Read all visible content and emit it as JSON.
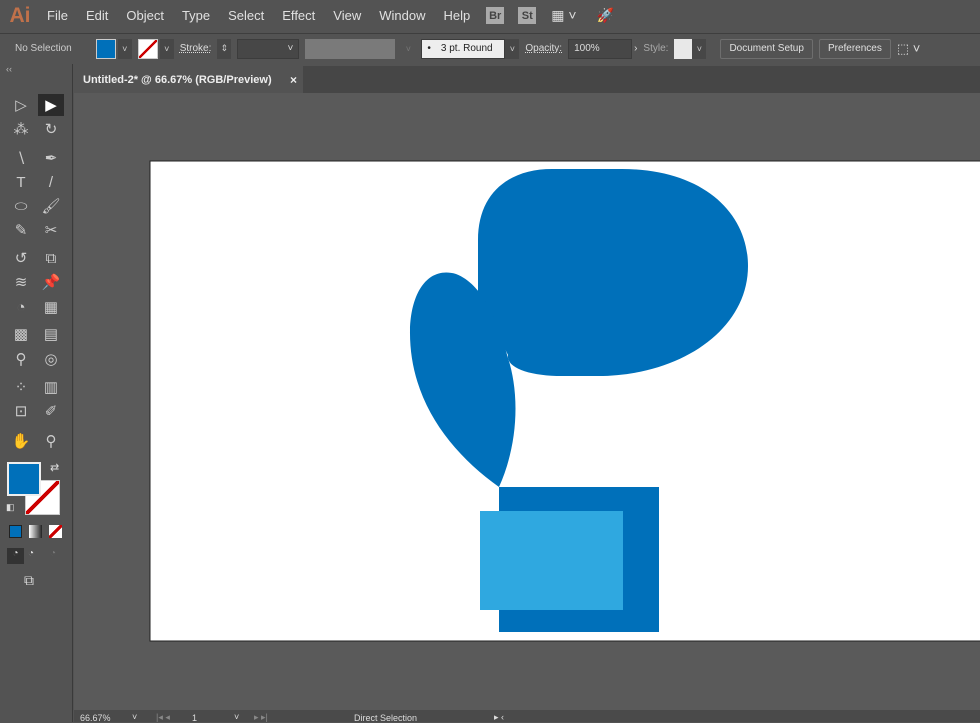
{
  "app": {
    "logo": "Ai",
    "menus": [
      "File",
      "Edit",
      "Object",
      "Type",
      "Select",
      "Effect",
      "View",
      "Window",
      "Help"
    ],
    "badges": [
      "Br",
      "St"
    ]
  },
  "control": {
    "selection": "No Selection",
    "fill_color": "#0070BA",
    "stroke_label": "Stroke:",
    "brush": "3 pt. Round",
    "opacity_label": "Opacity:",
    "opacity": "100%",
    "style_label": "Style:",
    "document_setup": "Document Setup",
    "preferences": "Preferences"
  },
  "document": {
    "tab_title": "Untitled-2* @ 66.67% (RGB/Preview)",
    "close": "×"
  },
  "tools": [
    [
      "direct-selection",
      "▷"
    ],
    [
      "selection",
      "▶"
    ],
    [
      "magic-wand",
      "⁂"
    ],
    [
      "lasso",
      "↻"
    ],
    [
      "curvature",
      "∖"
    ],
    [
      "pen",
      "✒"
    ],
    [
      "type",
      "T"
    ],
    [
      "line",
      "/"
    ],
    [
      "ellipse",
      "⬭"
    ],
    [
      "paintbrush",
      "🖌"
    ],
    [
      "shaper",
      "✎"
    ],
    [
      "scissors",
      "✂"
    ],
    [
      "rotate",
      "↺"
    ],
    [
      "scale",
      "⧉"
    ],
    [
      "warp",
      "≋"
    ],
    [
      "puppet-warp",
      "📌"
    ],
    [
      "shape-builder",
      "◔"
    ],
    [
      "perspective-grid",
      "▦"
    ],
    [
      "mesh",
      "▩"
    ],
    [
      "gradient",
      "▤"
    ],
    [
      "eyedropper",
      "⚲"
    ],
    [
      "blend",
      "◎"
    ],
    [
      "symbol-sprayer",
      "⁘"
    ],
    [
      "column-graph",
      "▥"
    ],
    [
      "artboard",
      "⊡"
    ],
    [
      "slice",
      "✐"
    ],
    [
      "hand",
      "✋"
    ],
    [
      "zoom",
      "⚲"
    ]
  ],
  "colors": {
    "fill": "#0070BA",
    "dark_shape": "#0070BA",
    "light_shape": "#2FA8E0"
  },
  "status": {
    "zoom": "66.67%",
    "artboard": "1",
    "tool": "Direct Selection"
  }
}
